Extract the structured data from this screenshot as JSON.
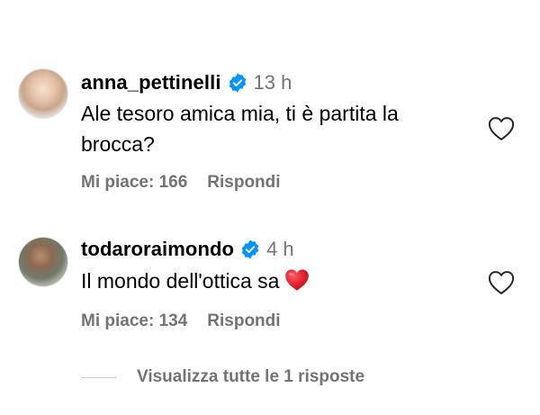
{
  "comments": [
    {
      "username": "anna_pettinelli",
      "time": "13 h",
      "text_line1": "Ale tesoro amica mia, ti è partita la",
      "text_line2": "brocca?",
      "likes": "Mi piace: 166",
      "reply": "Rispondi"
    },
    {
      "username": "todaroraimondo",
      "time": "4 h",
      "text": "Il mondo dell'ottica sa",
      "emoji": "red-heart",
      "likes": "Mi piace: 134",
      "reply": "Rispondi"
    }
  ],
  "view_replies": "Visualizza tutte le 1 risposte",
  "colors": {
    "verified": "#0095f6",
    "muted": "#737373",
    "heart_emoji": "#e0202d"
  }
}
